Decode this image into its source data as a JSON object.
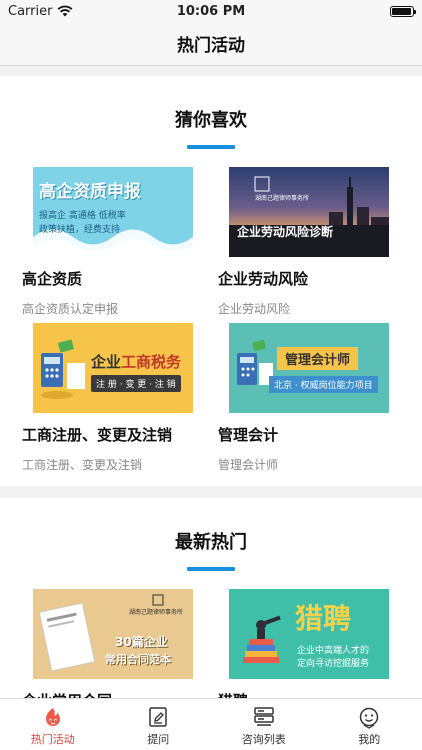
{
  "status": {
    "carrier": "Carrier",
    "time": "10:06 PM",
    "battery": 0.95
  },
  "nav": {
    "title": "热门活动"
  },
  "colors": {
    "accent": "#1a91e0",
    "tab_active": "#e63b3b"
  },
  "sections": [
    {
      "title": "猜你喜欢",
      "cards": [
        {
          "title": "高企资质",
          "subtitle": "高企资质认定申报",
          "banner": {
            "heading": "高企资质申报",
            "line1": "报高企  高通格  低税率",
            "line2": "政策扶植，经费支持"
          }
        },
        {
          "title": "企业劳动风险",
          "subtitle": "企业劳动风险",
          "banner": {
            "firm": "湖南己题律师事务所",
            "heading": "企业劳动风险诊断"
          }
        },
        {
          "title": "工商注册、变更及注销",
          "subtitle": "工商注册、变更及注销",
          "banner": {
            "heading_a": "企业",
            "heading_b": "工商税务",
            "tagline": "注 册 · 变 更 · 注 销"
          }
        },
        {
          "title": "管理会计",
          "subtitle": "管理会计师",
          "banner": {
            "heading": "管理会计师",
            "tagline": "北京 · 权威岗位能力项目"
          }
        }
      ]
    },
    {
      "title": "最新热门",
      "cards": [
        {
          "title": "企业常用合同",
          "banner": {
            "firm": "湖南己题律师事务所",
            "heading": "30篇企业",
            "heading2": "常用合同范本"
          }
        },
        {
          "title": "猎聘",
          "banner": {
            "heading": "猎聘",
            "line1": "企业中高端人才的",
            "line2": "定向寻访挖掘服务"
          }
        }
      ]
    }
  ],
  "tabs": [
    {
      "label": "热门活动",
      "icon": "hot-icon",
      "active": true
    },
    {
      "label": "提问",
      "icon": "edit-icon",
      "active": false
    },
    {
      "label": "咨询列表",
      "icon": "list-icon",
      "active": false
    },
    {
      "label": "我的",
      "icon": "profile-icon",
      "active": false
    }
  ]
}
